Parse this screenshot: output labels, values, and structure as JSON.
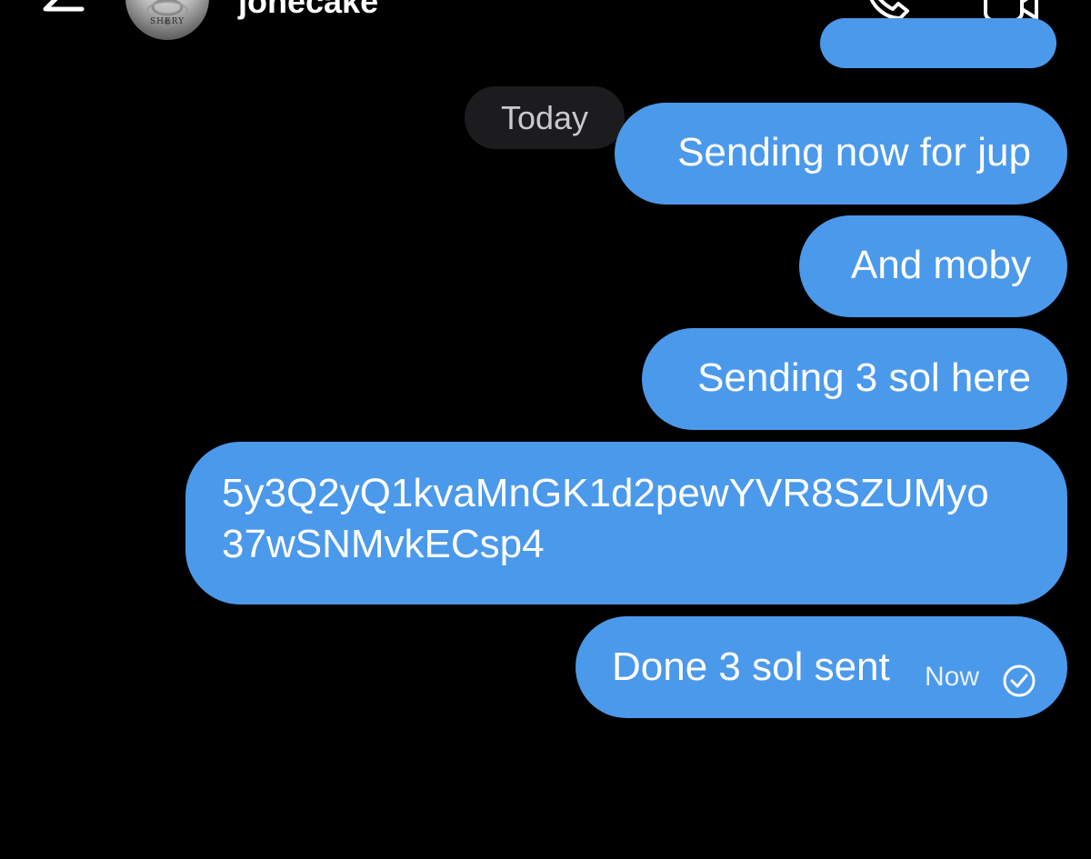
{
  "header": {
    "contact_name": "jonecake",
    "avatar_caption": "SHERY",
    "back_icon": "arrow-left-icon",
    "call_icon": "phone-icon",
    "video_icon": "video-camera-icon"
  },
  "chat": {
    "day_separator": "Today",
    "messages": [
      {
        "text": "Sending now for jup"
      },
      {
        "text": "And moby"
      },
      {
        "text": "Sending 3 sol here"
      },
      {
        "text_line1": "5y3Q2yQ1kvaMnGK1d2pewYVR8SZUMyo",
        "text_line2": "37wSNMvkECsp4"
      },
      {
        "text": "Done 3 sol sent",
        "time": "Now",
        "status_icon": "read-check-icon"
      }
    ]
  },
  "colors": {
    "background": "#000000",
    "bubble": "#4b99ea",
    "pill": "#1c1c1e"
  }
}
